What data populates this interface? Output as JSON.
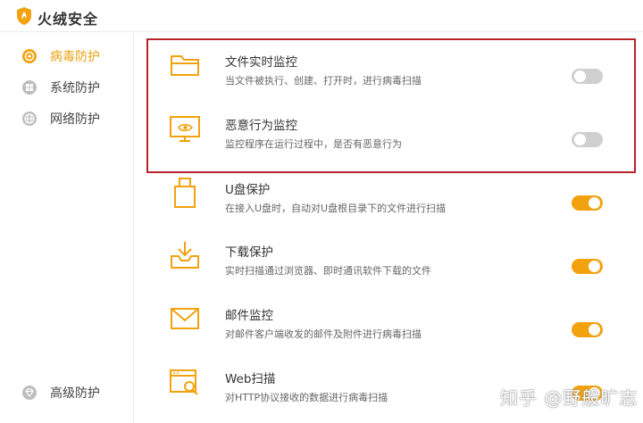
{
  "app": {
    "title": "火绒安全"
  },
  "sidebar": {
    "items": [
      {
        "label": "病毒防护",
        "icon": "virus-shield-icon",
        "active": true
      },
      {
        "label": "系统防护",
        "icon": "windows-icon",
        "active": false
      },
      {
        "label": "网络防护",
        "icon": "globe-icon",
        "active": false
      }
    ],
    "bottom_item": {
      "label": "高级防护",
      "icon": "diamond-icon"
    }
  },
  "features": [
    {
      "title": "文件实时监控",
      "desc": "当文件被执行、创建、打开时，进行病毒扫描",
      "icon": "folder-icon",
      "enabled": false
    },
    {
      "title": "恶意行为监控",
      "desc": "监控程序在运行过程中，是否有恶意行为",
      "icon": "monitor-eye-icon",
      "enabled": false
    },
    {
      "title": "U盘保护",
      "desc": "在接入U盘时，自动对U盘根目录下的文件进行扫描",
      "icon": "usb-drive-icon",
      "enabled": true
    },
    {
      "title": "下载保护",
      "desc": "实时扫描通过浏览器、即时通讯软件下载的文件",
      "icon": "download-tray-icon",
      "enabled": true
    },
    {
      "title": "邮件监控",
      "desc": "对邮件客户端收发的邮件及附件进行病毒扫描",
      "icon": "mail-icon",
      "enabled": true
    },
    {
      "title": "Web扫描",
      "desc": "对HTTP协议接收的数据进行病毒扫描",
      "icon": "web-scan-icon",
      "enabled": true
    }
  ],
  "watermark": "知乎 @野般旷志",
  "colors": {
    "accent": "#f2a20f",
    "highlight_border": "#b8232a",
    "toggle_off": "#cfcfcf"
  }
}
